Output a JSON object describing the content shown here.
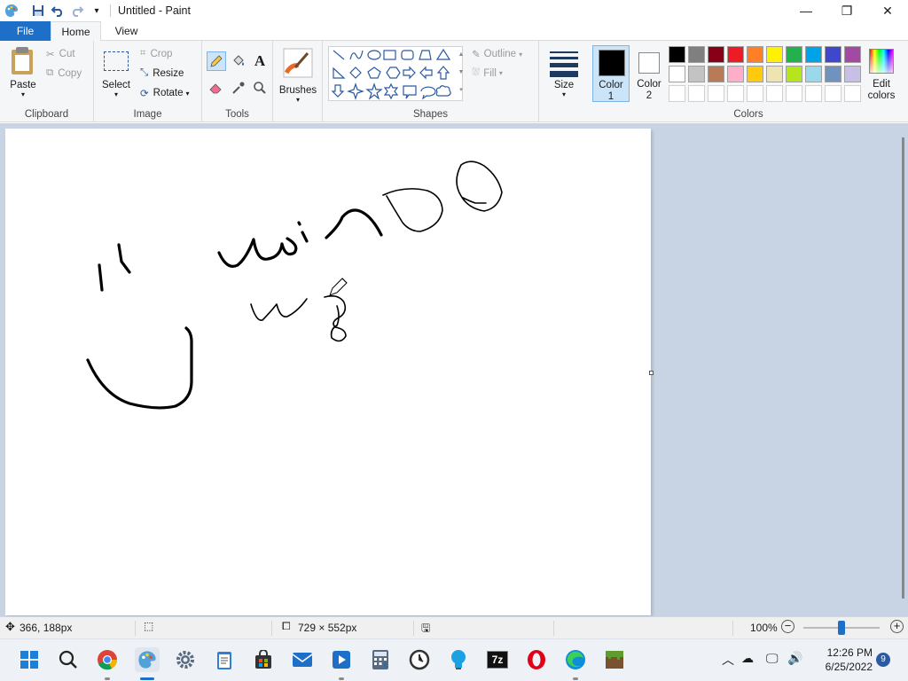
{
  "window": {
    "title": "Untitled - Paint"
  },
  "tabs": {
    "file": "File",
    "home": "Home",
    "view": "View"
  },
  "clipboard": {
    "paste": "Paste",
    "cut": "Cut",
    "copy": "Copy",
    "label": "Clipboard"
  },
  "image": {
    "select": "Select",
    "crop": "Crop",
    "resize": "Resize",
    "rotate": "Rotate",
    "label": "Image"
  },
  "tools": {
    "label": "Tools"
  },
  "brushes": {
    "label": "Brushes"
  },
  "shapes": {
    "outline": "Outline",
    "fill": "Fill",
    "label": "Shapes"
  },
  "size": {
    "label": "Size"
  },
  "color1": {
    "label_a": "Color",
    "label_b": "1",
    "value": "#000000"
  },
  "color2": {
    "label_a": "Color",
    "label_b": "2",
    "value": "#ffffff"
  },
  "colors": {
    "label": "Colors",
    "edit_a": "Edit",
    "edit_b": "colors",
    "row1": [
      "#000000",
      "#7f7f7f",
      "#880015",
      "#ed1c24",
      "#ff7f27",
      "#fff200",
      "#22b14c",
      "#00a2e8",
      "#3f48cc",
      "#a349a4"
    ],
    "row2": [
      "#ffffff",
      "#c3c3c3",
      "#b97a57",
      "#ffaec9",
      "#ffc90e",
      "#efe4b0",
      "#b5e61d",
      "#99d9ea",
      "#7092be",
      "#c8bfe7"
    ]
  },
  "status": {
    "cursor": "366, 188px",
    "size": "729 × 552px",
    "zoom": "100%"
  },
  "clock": {
    "time": "12:26 PM",
    "date": "6/25/2022"
  },
  "notification_count": "9"
}
